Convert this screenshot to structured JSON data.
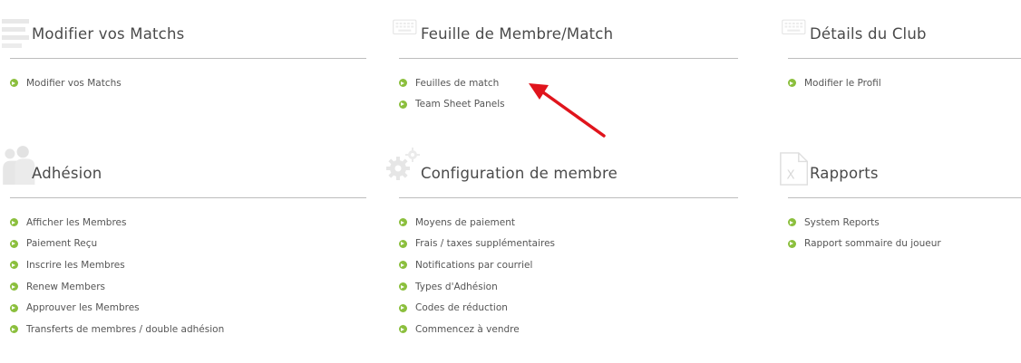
{
  "sections": [
    {
      "title": "Modifier vos Matchs",
      "icon": "lines-icon",
      "links": [
        "Modifier vos Matchs"
      ]
    },
    {
      "title": "Feuille de Membre/Match",
      "icon": "keyboard-icon",
      "links": [
        "Feuilles de match",
        "Team Sheet Panels"
      ]
    },
    {
      "title": "Détails du Club",
      "icon": "keyboard-icon",
      "links": [
        "Modifier le Profil"
      ]
    },
    {
      "title": "Adhésion",
      "icon": "users-icon",
      "links": [
        "Afficher les Membres",
        "Paiement Reçu",
        "Inscrire les Membres",
        "Renew Members",
        "Approuver les Membres",
        "Transferts de membres / double adhésion"
      ]
    },
    {
      "title": "Configuration de membre",
      "icon": "gears-icon",
      "links": [
        "Moyens de paiement",
        "Frais / taxes supplémentaires",
        "Notifications par courriel",
        "Types d'Adhésion",
        "Codes de réduction",
        "Commencez à vendre"
      ]
    },
    {
      "title": "Rapports",
      "icon": "excel-file-icon",
      "links": [
        "System Reports",
        "Rapport sommaire du joueur"
      ]
    }
  ],
  "colors": {
    "bullet": "#8bbf3d",
    "arrow": "#e0141c",
    "rule": "#bdbdbd",
    "icon_faint": "#e6e6e6"
  }
}
